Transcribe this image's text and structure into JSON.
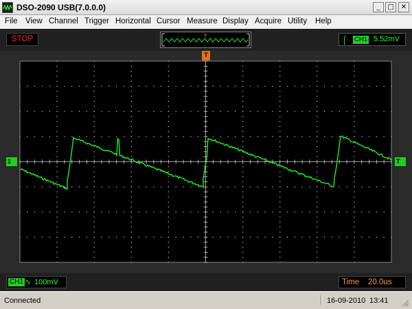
{
  "window": {
    "title": "DSO-2090 USB(7.0.0.0)",
    "minimize": "_",
    "maximize": "□",
    "close": "✕"
  },
  "menu": [
    "File",
    "View",
    "Channel",
    "Trigger",
    "Horizontal",
    "Cursor",
    "Measure",
    "Display",
    "Acquire",
    "Utility",
    "Help"
  ],
  "toolbar": {
    "run_state": "STOP",
    "trigger_marker_label": "T",
    "trigger": {
      "edge_icon": "rising-edge-icon",
      "edge_glyph": "⌠",
      "channel": "CH1",
      "level": "5.52mV"
    }
  },
  "scope": {
    "time_marker_label": "T",
    "channel_marker_label": "1",
    "trigger_level_label": "T",
    "colors": {
      "trace": "#22ee22",
      "grid": "#cccccc",
      "background": "#000000"
    }
  },
  "info": {
    "channel": "CH1",
    "coupling": "∿",
    "volts_per_div": "100mV",
    "time_label": "Time",
    "time_per_div": "20.0us"
  },
  "status": {
    "text": "Connected",
    "date": "16-09-2010",
    "time": "13:41"
  }
}
